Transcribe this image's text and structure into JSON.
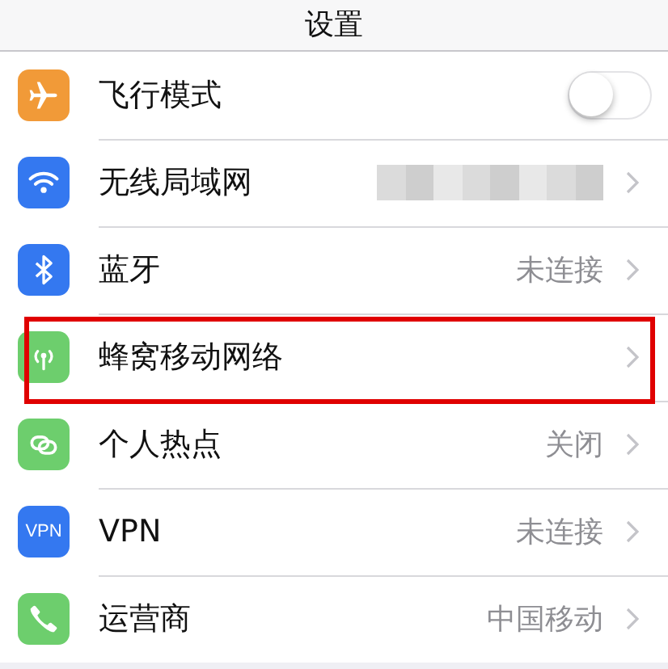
{
  "title": "设置",
  "rows": [
    {
      "label": "飞行模式",
      "kind": "toggle",
      "on": false,
      "color": "#f19a38",
      "highlighted": false
    },
    {
      "label": "无线局域网",
      "kind": "link",
      "redacted": true,
      "color": "#3478f0",
      "highlighted": false
    },
    {
      "label": "蓝牙",
      "kind": "link",
      "value": "未连接",
      "color": "#3478f0",
      "highlighted": false
    },
    {
      "label": "蜂窝移动网络",
      "kind": "link",
      "color": "#6dce6d",
      "highlighted": true
    },
    {
      "label": "个人热点",
      "kind": "link",
      "value": "关闭",
      "color": "#6dce6d",
      "highlighted": false
    },
    {
      "label": "VPN",
      "kind": "link",
      "value": "未连接",
      "color": "#3478f0",
      "icon_text": "VPN",
      "highlighted": false
    },
    {
      "label": "运营商",
      "kind": "link",
      "value": "中国移动",
      "color": "#6dce6d",
      "highlighted": false
    }
  ]
}
